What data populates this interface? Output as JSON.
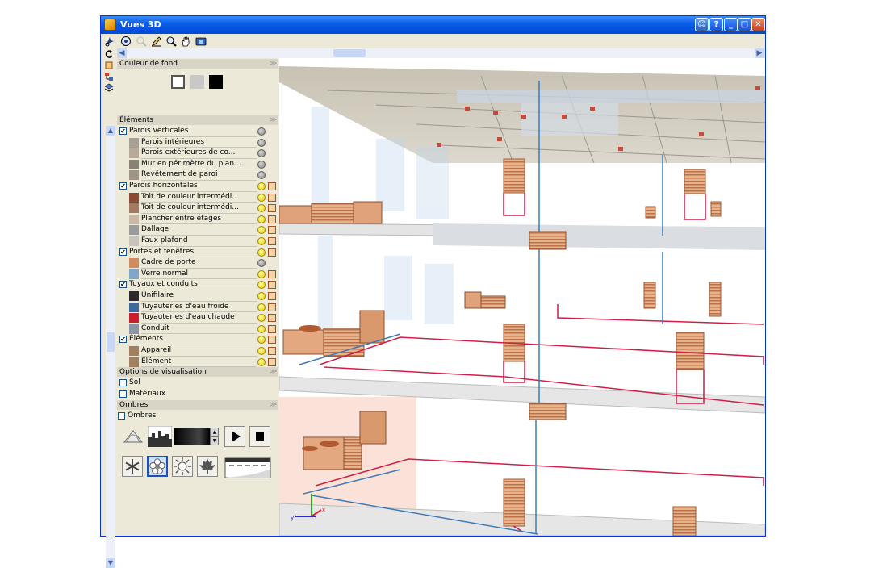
{
  "window": {
    "title": "Vues 3D"
  },
  "panel": {
    "background_section": {
      "title": "Couleur de fond",
      "swatches": [
        "#ffffff",
        "#c8c8c8",
        "#000000"
      ]
    },
    "elements_section": {
      "title": "Éléments",
      "groups": [
        {
          "label": "Parois verticales",
          "checked": true,
          "visible": false,
          "items": [
            {
              "label": "Parois intérieures",
              "color": "#a9a095",
              "visible": false
            },
            {
              "label": "Parois extérieures de co...",
              "color": "#b8aa98",
              "visible": false
            },
            {
              "label": "Mur en périmètre du plan...",
              "color": "#878274",
              "visible": false
            },
            {
              "label": "Revêtement de paroi",
              "color": "#9f9485",
              "visible": false
            }
          ]
        },
        {
          "label": "Parois horizontales",
          "checked": true,
          "visible": true,
          "items": [
            {
              "label": "Toit de couleur intermédi...",
              "color": "#8a4a35",
              "visible": true
            },
            {
              "label": "Toit de couleur intermédi...",
              "color": "#a27a63",
              "visible": true
            },
            {
              "label": "Plancher entre étages",
              "color": "#c9b8a6",
              "visible": true
            },
            {
              "label": "Dallage",
              "color": "#9b9b9b",
              "visible": true
            },
            {
              "label": "Faux plafond",
              "color": "#c8c4bc",
              "visible": true
            }
          ]
        },
        {
          "label": "Portes et fenêtres",
          "checked": true,
          "visible": true,
          "items": [
            {
              "label": "Cadre de porte",
              "color": "#d08c5e",
              "visible": false
            },
            {
              "label": "Verre normal",
              "color": "#7fa8c8",
              "visible": true
            }
          ]
        },
        {
          "label": "Tuyaux et conduits",
          "checked": true,
          "visible": true,
          "items": [
            {
              "label": "Unifilaire",
              "color": "#2a2a2a",
              "visible": true
            },
            {
              "label": "Tuyauteries d'eau froide",
              "color": "#3a6a9a",
              "visible": true
            },
            {
              "label": "Tuyauteries d'eau chaude",
              "color": "#c8202a",
              "visible": true
            },
            {
              "label": "Conduit",
              "color": "#8a96a8",
              "visible": true
            }
          ]
        },
        {
          "label": "Éléments",
          "checked": true,
          "visible": true,
          "items": [
            {
              "label": "Appareil",
              "color": "#a08060",
              "visible": true
            },
            {
              "label": "Élément",
              "color": "#a08060",
              "visible": true
            }
          ]
        }
      ]
    },
    "view_options_section": {
      "title": "Options de visualisation",
      "options": [
        {
          "label": "Sol",
          "checked": false
        },
        {
          "label": "Matériaux",
          "checked": false
        }
      ]
    },
    "shadows_section": {
      "title": "Ombres",
      "checkbox_label": "Ombres",
      "checked": false
    }
  },
  "toolbar_icons": [
    "orbit-icon",
    "zoom-extent-icon",
    "zoom-window-icon",
    "pencil-icon",
    "zoom-icon",
    "pan-hand-icon",
    "camera-icon"
  ],
  "side_icons": [
    "rotate-icon",
    "cube-view-icon",
    "tree-view-icon",
    "layers-icon"
  ],
  "colors": {
    "accent": "#0A5FE8",
    "panel_bg": "#ECE9D8",
    "pipe_hot": "#d41c46",
    "pipe_cold": "#3d7ab8",
    "wood": "#d9a070"
  }
}
